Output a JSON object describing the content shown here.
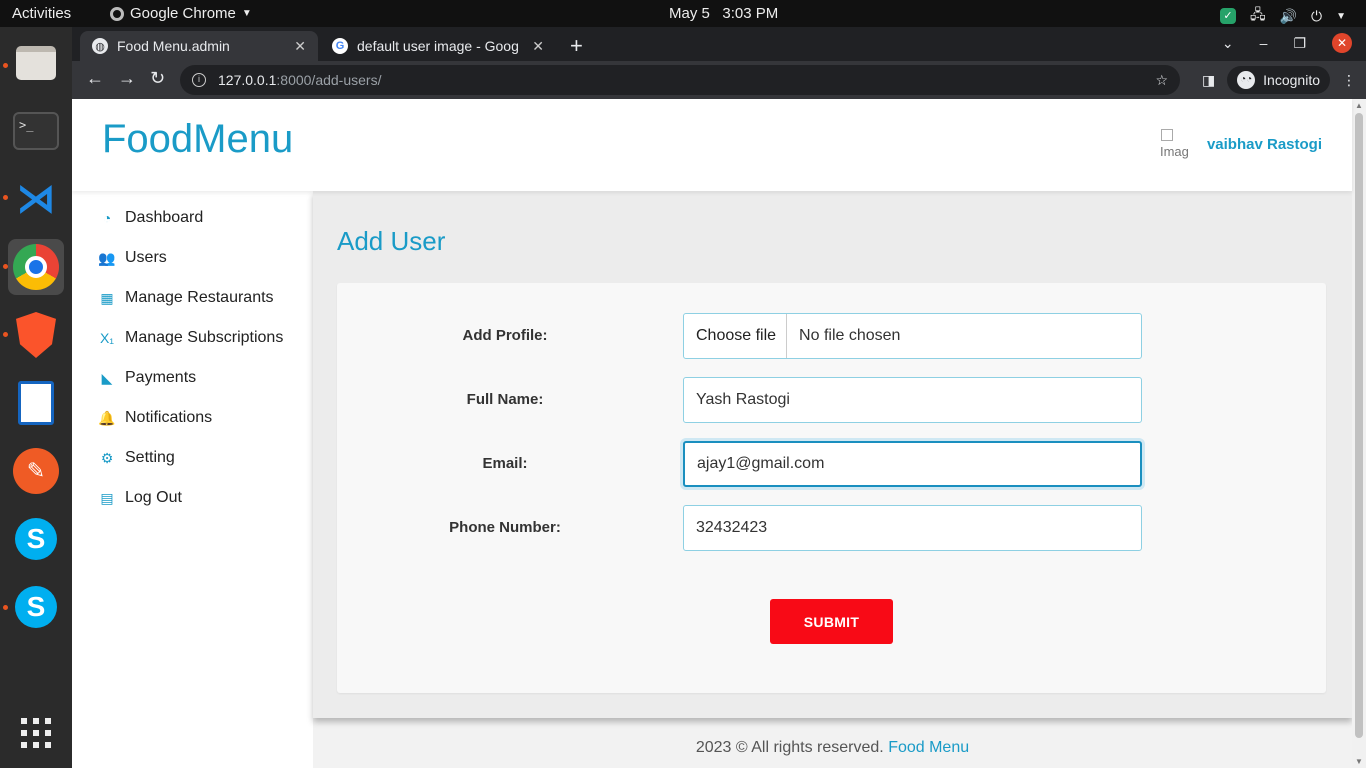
{
  "topbar": {
    "activities": "Activities",
    "app_name": "Google Chrome",
    "clock": "May 5   3:03 PM"
  },
  "dock": {
    "apps": [
      "files-icon",
      "terminal-icon",
      "vscode-icon",
      "chrome-icon",
      "brave-icon",
      "writer-icon",
      "postman-icon",
      "skype-icon",
      "skype-icon",
      "app-grid-icon"
    ]
  },
  "browser": {
    "tabs": [
      {
        "title": "Food Menu.admin",
        "active": true
      },
      {
        "title": "default user image - Goog",
        "active": false
      }
    ],
    "url_host": "127.0.0.1",
    "url_path": ":8000/add-users/",
    "incognito_label": "Incognito"
  },
  "site": {
    "logo": "FoodMenu",
    "avatar_alt": "Imag",
    "username": "vaibhav Rastogi"
  },
  "sidebar": {
    "items": [
      {
        "label": "Dashboard",
        "icon": "dashboard-icon",
        "glyph": "◔"
      },
      {
        "label": "Users",
        "icon": "users-icon",
        "glyph": "👥"
      },
      {
        "label": "Manage Restaurants",
        "icon": "building-icon",
        "glyph": "▦"
      },
      {
        "label": "Manage Subscriptions",
        "icon": "subscript-icon",
        "glyph": "X₁"
      },
      {
        "label": "Payments",
        "icon": "satellite-icon",
        "glyph": "◣"
      },
      {
        "label": "Notifications",
        "icon": "bell-icon",
        "glyph": "🔔"
      },
      {
        "label": "Setting",
        "icon": "gear-icon",
        "glyph": "⚙"
      },
      {
        "label": "Log Out",
        "icon": "id-card-icon",
        "glyph": "▤"
      }
    ]
  },
  "form": {
    "title": "Add User",
    "profile_label": "Add Profile:",
    "file_button": "Choose file",
    "file_status": "No file chosen",
    "fullname_label": "Full Name:",
    "fullname_value": "Yash Rastogi",
    "email_label": "Email:",
    "email_value": "ajay1@gmail.com",
    "phone_label": "Phone Number:",
    "phone_value": "32432423",
    "submit_label": "SUBMIT"
  },
  "footer": {
    "text": "2023 © All rights reserved. ",
    "link": "Food Menu"
  }
}
